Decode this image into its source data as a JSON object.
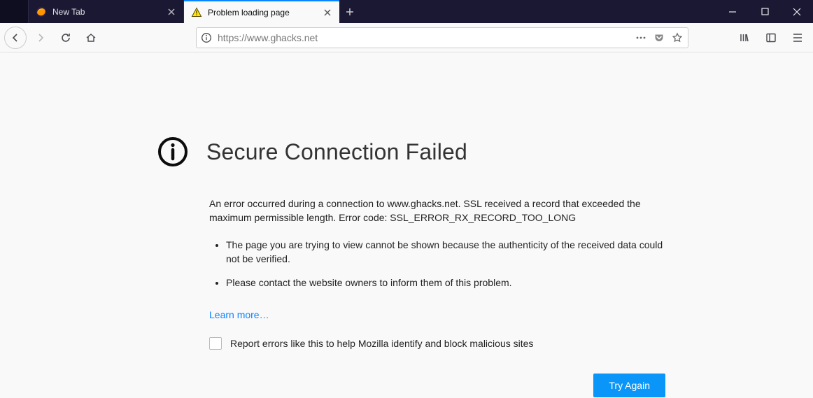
{
  "tabs": {
    "t0_label": "New Tab",
    "t1_label": "Problem loading page"
  },
  "urlbar": {
    "url": "https://www.ghacks.net"
  },
  "error": {
    "title": "Secure Connection Failed",
    "description": "An error occurred during a connection to www.ghacks.net. SSL received a record that exceeded the maximum permissible length. Error code: SSL_ERROR_RX_RECORD_TOO_LONG",
    "bullet1": "The page you are trying to view cannot be shown because the authenticity of the received data could not be verified.",
    "bullet2": "Please contact the website owners to inform them of this problem.",
    "learn_more": "Learn more…",
    "report_label": "Report errors like this to help Mozilla identify and block malicious sites",
    "try_again": "Try Again"
  }
}
